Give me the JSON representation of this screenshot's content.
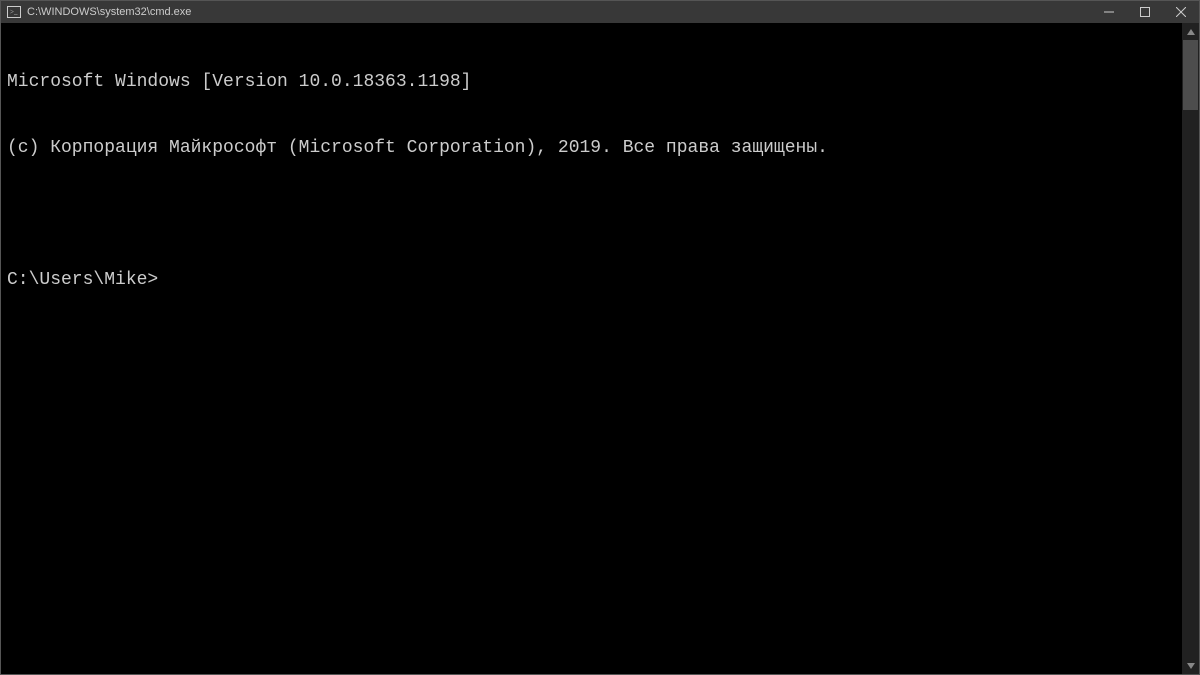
{
  "window": {
    "title": "C:\\WINDOWS\\system32\\cmd.exe"
  },
  "terminal": {
    "line1": "Microsoft Windows [Version 10.0.18363.1198]",
    "line2": "(c) Корпорация Майкрософт (Microsoft Corporation), 2019. Все права защищены.",
    "prompt": "C:\\Users\\Mike>"
  }
}
